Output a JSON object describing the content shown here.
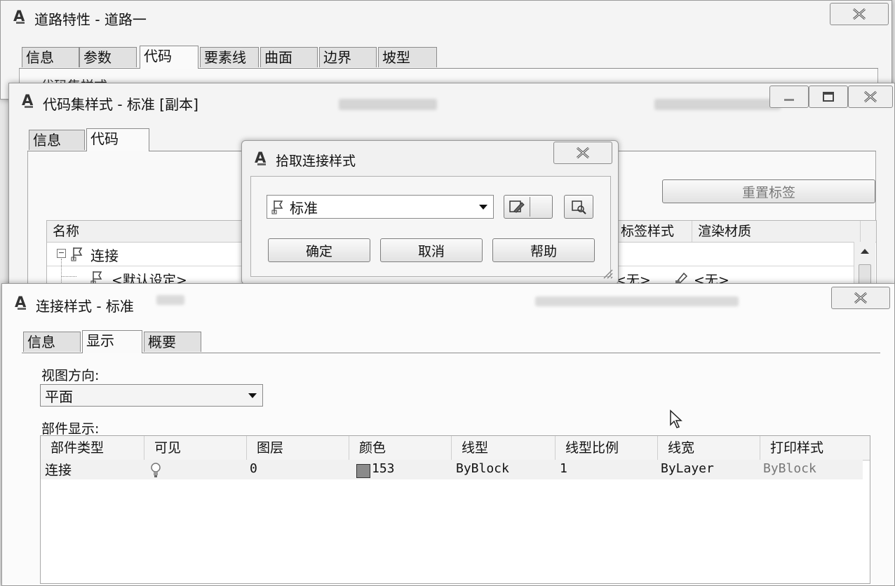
{
  "road_window": {
    "title": "道路特性 - 道路一",
    "tabs": [
      "信息",
      "参数",
      "代码",
      "要素线",
      "曲面",
      "边界",
      "坡型"
    ],
    "active_tab": 2,
    "section_label": "代码集样式"
  },
  "codeset_window": {
    "title": "代码集样式 - 标准 [副本]",
    "tabs": [
      "信息",
      "代码"
    ],
    "active_tab": 1,
    "reset_labels_button": "重置标签",
    "columns": {
      "name": "名称",
      "label_style": "标签样式",
      "render_material": "渲染材质"
    },
    "tree": [
      {
        "label": "连接",
        "expanded": true,
        "label_style": "",
        "render_material": ""
      },
      {
        "label": "<默认设定>",
        "label_style": "<无>",
        "render_material": "<无>"
      }
    ]
  },
  "pick_dialog": {
    "title": "拾取连接样式",
    "selected_style": "标准",
    "ok": "确定",
    "cancel": "取消",
    "help": "帮助"
  },
  "link_style_window": {
    "title": "连接样式 - 标准",
    "tabs": [
      "信息",
      "显示",
      "概要"
    ],
    "active_tab": 1,
    "view_direction_label": "视图方向:",
    "view_direction_value": "平面",
    "component_display_label": "部件显示:",
    "columns": [
      "部件类型",
      "可见",
      "图层",
      "颜色",
      "线型",
      "线型比例",
      "线宽",
      "打印样式"
    ],
    "rows": [
      {
        "type": "连接",
        "visible": true,
        "layer": "0",
        "color": "153",
        "color_hex": "#8a8a8a",
        "linetype": "ByBlock",
        "linetype_scale": "1",
        "lineweight": "ByLayer",
        "plot_style": "ByBlock"
      }
    ]
  },
  "icons": {
    "app": "autocad-icon",
    "close": "close-icon",
    "minimize": "minimize-icon",
    "maximize": "maximize-icon",
    "style": "style-flag-icon",
    "edit": "edit-icon",
    "pick": "pick-from-drawing-icon",
    "bulb": "lightbulb-icon",
    "cursor": "mouse-cursor-icon"
  }
}
